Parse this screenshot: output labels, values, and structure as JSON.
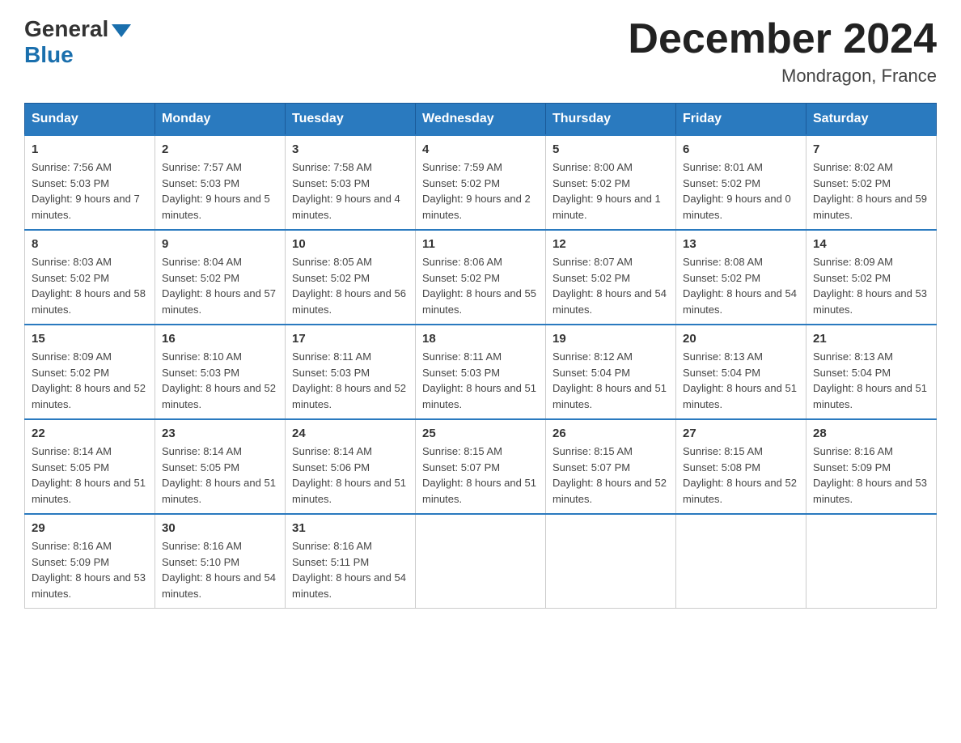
{
  "header": {
    "logo_general": "General",
    "logo_blue": "Blue",
    "main_title": "December 2024",
    "subtitle": "Mondragon, France"
  },
  "calendar": {
    "days_of_week": [
      "Sunday",
      "Monday",
      "Tuesday",
      "Wednesday",
      "Thursday",
      "Friday",
      "Saturday"
    ],
    "weeks": [
      [
        {
          "day": "1",
          "sunrise": "7:56 AM",
          "sunset": "5:03 PM",
          "daylight": "9 hours and 7 minutes."
        },
        {
          "day": "2",
          "sunrise": "7:57 AM",
          "sunset": "5:03 PM",
          "daylight": "9 hours and 5 minutes."
        },
        {
          "day": "3",
          "sunrise": "7:58 AM",
          "sunset": "5:03 PM",
          "daylight": "9 hours and 4 minutes."
        },
        {
          "day": "4",
          "sunrise": "7:59 AM",
          "sunset": "5:02 PM",
          "daylight": "9 hours and 2 minutes."
        },
        {
          "day": "5",
          "sunrise": "8:00 AM",
          "sunset": "5:02 PM",
          "daylight": "9 hours and 1 minute."
        },
        {
          "day": "6",
          "sunrise": "8:01 AM",
          "sunset": "5:02 PM",
          "daylight": "9 hours and 0 minutes."
        },
        {
          "day": "7",
          "sunrise": "8:02 AM",
          "sunset": "5:02 PM",
          "daylight": "8 hours and 59 minutes."
        }
      ],
      [
        {
          "day": "8",
          "sunrise": "8:03 AM",
          "sunset": "5:02 PM",
          "daylight": "8 hours and 58 minutes."
        },
        {
          "day": "9",
          "sunrise": "8:04 AM",
          "sunset": "5:02 PM",
          "daylight": "8 hours and 57 minutes."
        },
        {
          "day": "10",
          "sunrise": "8:05 AM",
          "sunset": "5:02 PM",
          "daylight": "8 hours and 56 minutes."
        },
        {
          "day": "11",
          "sunrise": "8:06 AM",
          "sunset": "5:02 PM",
          "daylight": "8 hours and 55 minutes."
        },
        {
          "day": "12",
          "sunrise": "8:07 AM",
          "sunset": "5:02 PM",
          "daylight": "8 hours and 54 minutes."
        },
        {
          "day": "13",
          "sunrise": "8:08 AM",
          "sunset": "5:02 PM",
          "daylight": "8 hours and 54 minutes."
        },
        {
          "day": "14",
          "sunrise": "8:09 AM",
          "sunset": "5:02 PM",
          "daylight": "8 hours and 53 minutes."
        }
      ],
      [
        {
          "day": "15",
          "sunrise": "8:09 AM",
          "sunset": "5:02 PM",
          "daylight": "8 hours and 52 minutes."
        },
        {
          "day": "16",
          "sunrise": "8:10 AM",
          "sunset": "5:03 PM",
          "daylight": "8 hours and 52 minutes."
        },
        {
          "day": "17",
          "sunrise": "8:11 AM",
          "sunset": "5:03 PM",
          "daylight": "8 hours and 52 minutes."
        },
        {
          "day": "18",
          "sunrise": "8:11 AM",
          "sunset": "5:03 PM",
          "daylight": "8 hours and 51 minutes."
        },
        {
          "day": "19",
          "sunrise": "8:12 AM",
          "sunset": "5:04 PM",
          "daylight": "8 hours and 51 minutes."
        },
        {
          "day": "20",
          "sunrise": "8:13 AM",
          "sunset": "5:04 PM",
          "daylight": "8 hours and 51 minutes."
        },
        {
          "day": "21",
          "sunrise": "8:13 AM",
          "sunset": "5:04 PM",
          "daylight": "8 hours and 51 minutes."
        }
      ],
      [
        {
          "day": "22",
          "sunrise": "8:14 AM",
          "sunset": "5:05 PM",
          "daylight": "8 hours and 51 minutes."
        },
        {
          "day": "23",
          "sunrise": "8:14 AM",
          "sunset": "5:05 PM",
          "daylight": "8 hours and 51 minutes."
        },
        {
          "day": "24",
          "sunrise": "8:14 AM",
          "sunset": "5:06 PM",
          "daylight": "8 hours and 51 minutes."
        },
        {
          "day": "25",
          "sunrise": "8:15 AM",
          "sunset": "5:07 PM",
          "daylight": "8 hours and 51 minutes."
        },
        {
          "day": "26",
          "sunrise": "8:15 AM",
          "sunset": "5:07 PM",
          "daylight": "8 hours and 52 minutes."
        },
        {
          "day": "27",
          "sunrise": "8:15 AM",
          "sunset": "5:08 PM",
          "daylight": "8 hours and 52 minutes."
        },
        {
          "day": "28",
          "sunrise": "8:16 AM",
          "sunset": "5:09 PM",
          "daylight": "8 hours and 53 minutes."
        }
      ],
      [
        {
          "day": "29",
          "sunrise": "8:16 AM",
          "sunset": "5:09 PM",
          "daylight": "8 hours and 53 minutes."
        },
        {
          "day": "30",
          "sunrise": "8:16 AM",
          "sunset": "5:10 PM",
          "daylight": "8 hours and 54 minutes."
        },
        {
          "day": "31",
          "sunrise": "8:16 AM",
          "sunset": "5:11 PM",
          "daylight": "8 hours and 54 minutes."
        },
        null,
        null,
        null,
        null
      ]
    ]
  }
}
